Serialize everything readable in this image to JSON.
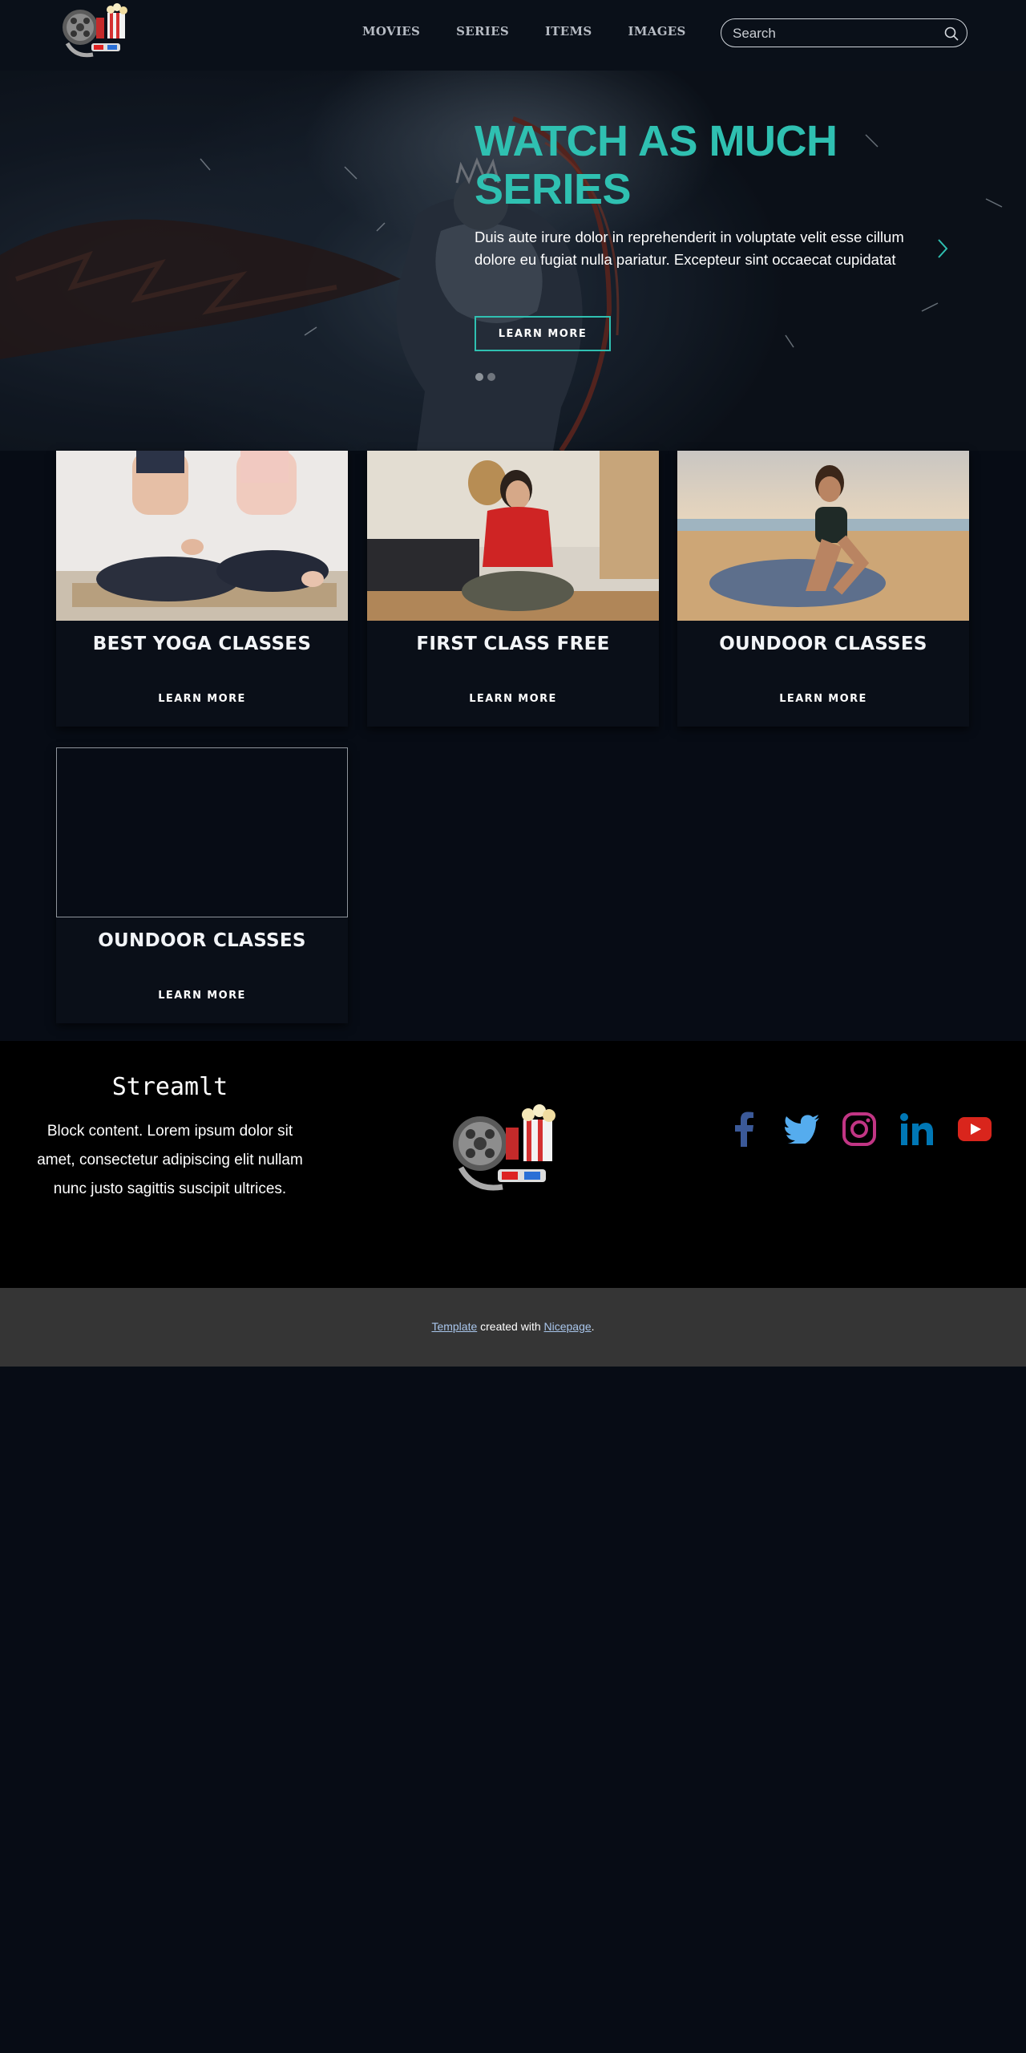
{
  "header": {
    "nav": [
      "MOVIES",
      "SERIES",
      "ITEMS",
      "IMAGES"
    ],
    "search_placeholder": "Search"
  },
  "hero": {
    "title": "WATCH AS MUCH SERIES",
    "text": "Duis aute irure dolor in reprehenderit in voluptate velit esse cillum dolore eu fugiat nulla pariatur. Excepteur sint occaecat cupidatat",
    "button": "LEARN MORE",
    "slide_count": 2,
    "active_slide": 1
  },
  "cards": [
    {
      "title": "BEST YOGA CLASSES",
      "link": "LEARN MORE"
    },
    {
      "title": "FIRST CLASS FREE",
      "link": "LEARN MORE"
    },
    {
      "title": "OUNDOOR CLASSES",
      "link": "LEARN MORE"
    },
    {
      "title": "OUNDOOR CLASSES",
      "link": "LEARN MORE"
    }
  ],
  "footer": {
    "brand": "Streamlt",
    "text": "Block content. Lorem ipsum dolor sit amet, consectetur adipiscing elit nullam nunc justo sagittis suscipit ultrices.",
    "socials": [
      "facebook-icon",
      "twitter-icon",
      "instagram-icon",
      "linkedin-icon",
      "youtube-icon"
    ]
  },
  "bottom": {
    "template_link": "Template",
    "middle": " created with ",
    "nicepage_link": "Nicepage",
    "end": "."
  },
  "colors": {
    "accent": "#2fc0b1",
    "background": "#070c15",
    "footer_bar": "#353535",
    "link": "#a9c6ec"
  }
}
